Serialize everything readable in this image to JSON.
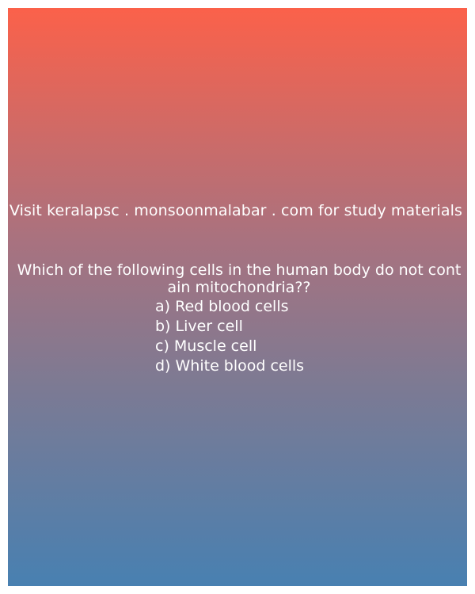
{
  "promo": {
    "text": "Visit keralapsc . monsoonmalabar . com for study materials"
  },
  "quiz": {
    "question": "Which of the following cells in the human body do not contain mitochondria??",
    "options": [
      "a) Red blood cells",
      "b) Liver cell",
      "c) Muscle cell",
      "d) White blood cells"
    ]
  },
  "colors": {
    "gradient_top": "#fb614a",
    "gradient_bottom": "#4880b1",
    "text": "#ffffff"
  }
}
